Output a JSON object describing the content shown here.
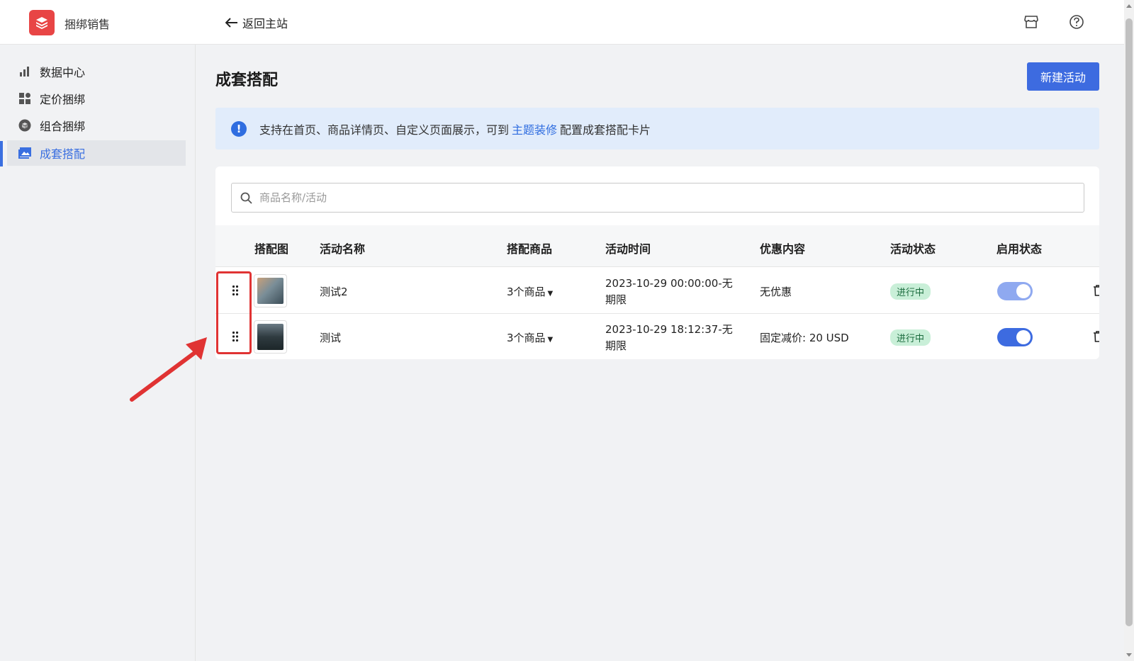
{
  "app": {
    "name": "捆绑销售",
    "back_label": "返回主站"
  },
  "sidebar": {
    "items": [
      {
        "label": "数据中心",
        "icon": "bar-chart-icon"
      },
      {
        "label": "定价捆绑",
        "icon": "grid-icon"
      },
      {
        "label": "组合捆绑",
        "icon": "box-icon"
      },
      {
        "label": "成套搭配",
        "icon": "image-icon",
        "active": true
      }
    ]
  },
  "page": {
    "title": "成套搭配",
    "new_button": "新建活动",
    "notice": {
      "text_before": "支持在首页、商品详情页、自定义页面展示，可到",
      "link": "主题装修",
      "text_after": "配置成套搭配卡片"
    },
    "search_placeholder": "商品名称/活动"
  },
  "table": {
    "headers": [
      "搭配图",
      "活动名称",
      "搭配商品",
      "活动时间",
      "优惠内容",
      "活动状态",
      "启用状态"
    ],
    "rows": [
      {
        "name": "测试2",
        "products": "3个商品",
        "time_line1": "2023-10-29 00:00:00-无",
        "time_line2": "期限",
        "discount": "无优惠",
        "status": "进行中",
        "enabled": true,
        "toggle_color": "#8fa9f0"
      },
      {
        "name": "测试",
        "products": "3个商品",
        "time_line1": "2023-10-29 18:12:37-无",
        "time_line2": "期限",
        "discount": "固定减价: 20 USD",
        "status": "进行中",
        "enabled": true,
        "toggle_color": "#3d6be0"
      }
    ]
  },
  "colors": {
    "accent": "#3d6be0",
    "brand": "#e84545",
    "highlight": "#e03333"
  }
}
